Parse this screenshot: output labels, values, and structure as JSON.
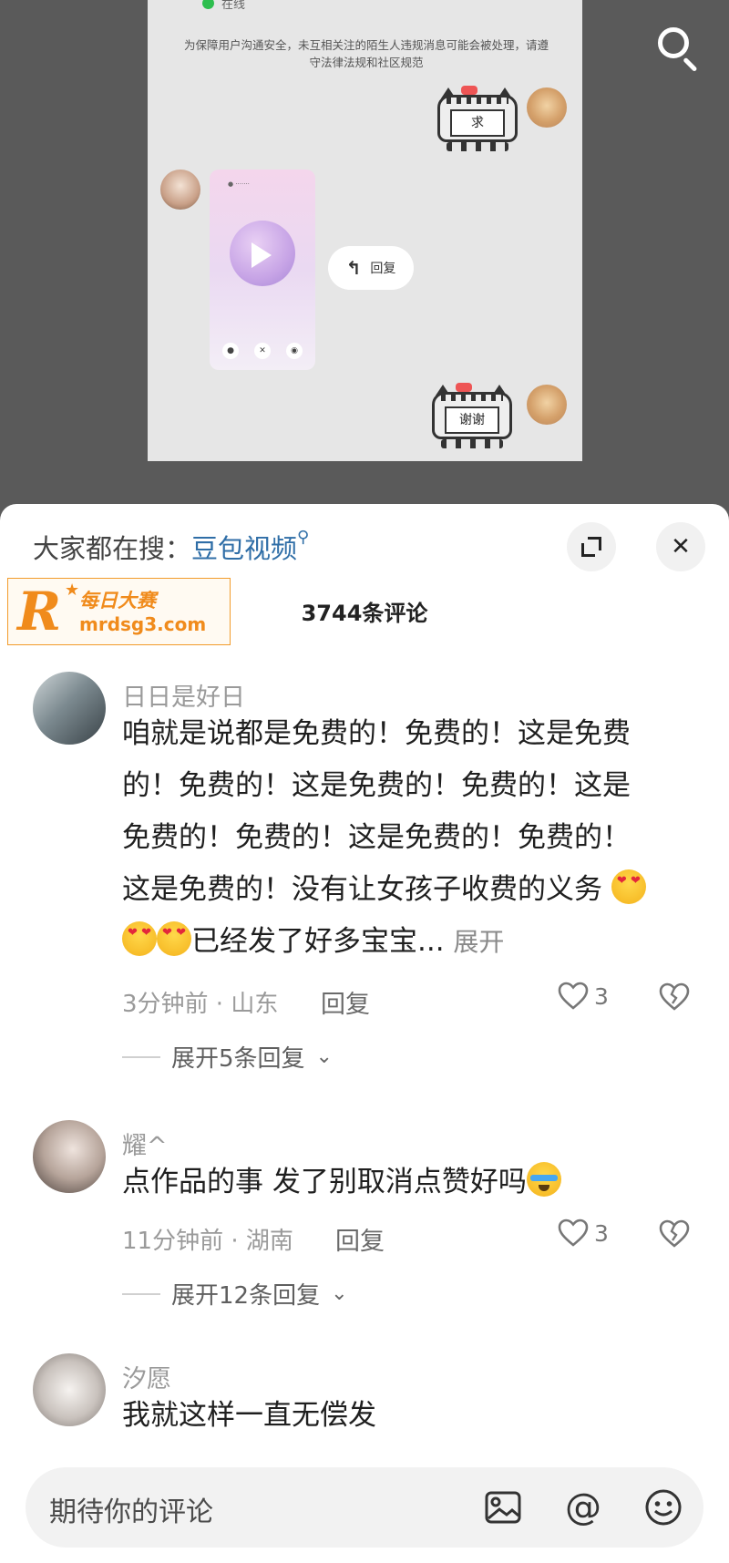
{
  "video": {
    "chat_status": "在线",
    "chat_notice": "为保障用户沟通安全，未互相关注的陌生人违规消息可能会被处理，请遵守法律法规和社区规范",
    "sticker_1_text": "求",
    "sticker_2_text": "谢谢",
    "reply_pill_label": "回复"
  },
  "sheet": {
    "hot_search_prefix": "大家都在搜：",
    "hot_search_keyword": "豆包视频",
    "comment_count": "3744条评论",
    "watermark": {
      "letter": "R",
      "brand": "每日大赛",
      "url": "mrdsg3.com"
    }
  },
  "comments": [
    {
      "name": "日日是好日",
      "text_line1": "咱就是说都是免费的！免费的！这是免费",
      "text_line2": "的！免费的！这是免费的！免费的！这是",
      "text_line3": "免费的！免费的！这是免费的！免费的！",
      "text_line4": "这是免费的！没有让女孩子收费的义务",
      "text_line5": "已经发了好多宝宝...",
      "more": "展开",
      "meta": "3分钟前 · 山东",
      "reply": "回复",
      "likes": "3",
      "expand": "展开5条回复"
    },
    {
      "name": "耀^",
      "text_line1": "点作品的事 发了别取消点赞好吗",
      "meta": "11分钟前 · 湖南",
      "reply": "回复",
      "likes": "3",
      "expand": "展开12条回复"
    },
    {
      "name": "汐愿",
      "text_line1": "我就这样一直无偿发"
    }
  ],
  "input": {
    "placeholder": "期待你的评论"
  }
}
